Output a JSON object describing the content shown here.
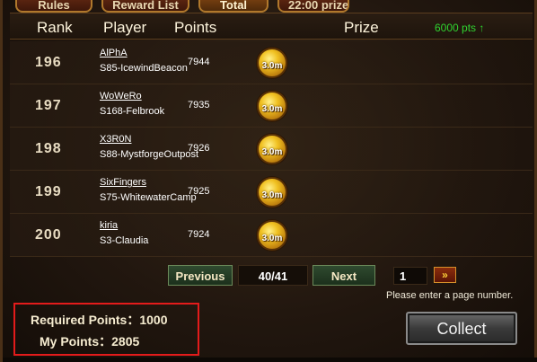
{
  "tabs": [
    {
      "label": "Rules"
    },
    {
      "label": "Reward List"
    },
    {
      "label": "Total"
    },
    {
      "label": "22:00 prize"
    }
  ],
  "header": {
    "rank": "Rank",
    "player": "Player",
    "points": "Points",
    "prize": "Prize",
    "bonus": "6000 pts ↑"
  },
  "rows": [
    {
      "rank": "196",
      "name": "AlPhA",
      "server": "S85-IcewindBeacon",
      "points": "7944",
      "prize": "3.0m"
    },
    {
      "rank": "197",
      "name": "WoWeRo",
      "server": "S168-Felbrook",
      "points": "7935",
      "prize": "3.0m"
    },
    {
      "rank": "198",
      "name": "X3R0N",
      "server": "S88-MystforgeOutpost",
      "points": "7926",
      "prize": "3.0m"
    },
    {
      "rank": "199",
      "name": "SixFingers",
      "server": "S75-WhitewaterCamp",
      "points": "7925",
      "prize": "3.0m"
    },
    {
      "rank": "200",
      "name": "kiria",
      "server": "S3-Claudia",
      "points": "7924",
      "prize": "3.0m"
    }
  ],
  "pagination": {
    "previous_label": "Previous",
    "page_indicator": "40/41",
    "next_label": "Next",
    "page_input_value": "1",
    "go_label": "»",
    "hint": "Please enter a page number."
  },
  "info": {
    "required_points": "Required Points：1000",
    "my_points": "My Points：2805"
  },
  "collect_label": "Collect",
  "colors": {
    "accent_green": "#2fd12f",
    "highlight_red": "#e31b1b",
    "coin_gold": "#f0c020"
  }
}
